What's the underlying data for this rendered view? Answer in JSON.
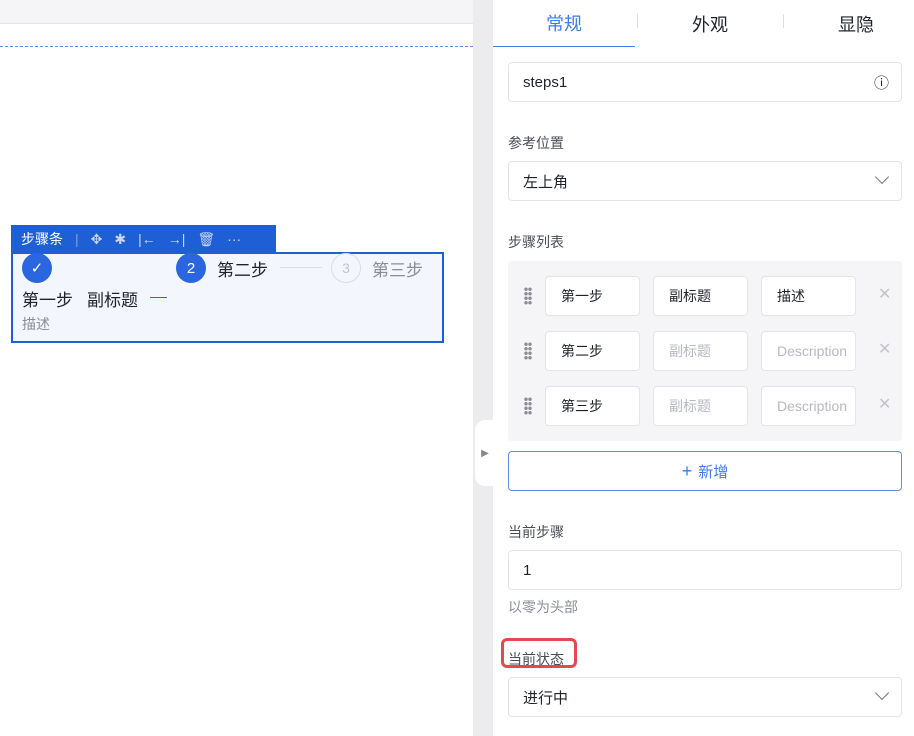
{
  "canvas": {
    "toolbar": {
      "title": "步骤条"
    },
    "steps": [
      {
        "title": "第一步",
        "subtitle": "副标题",
        "description": "描述",
        "status": "finish"
      },
      {
        "number": "2",
        "title": "第二步"
      },
      {
        "number": "3",
        "title": "第三步"
      }
    ]
  },
  "panel": {
    "tabs": [
      {
        "label": "常规",
        "active": true
      },
      {
        "label": "外观"
      },
      {
        "label": "显隐"
      }
    ],
    "name_value": "steps1",
    "position": {
      "label": "参考位置",
      "value": "左上角"
    },
    "steps_list": {
      "label": "步骤列表",
      "rows": [
        {
          "title": "第一步",
          "subtitle": "副标题",
          "description": "描述"
        },
        {
          "title": "第二步",
          "subtitle_placeholder": "副标题",
          "description_placeholder": "Description"
        },
        {
          "title": "第三步",
          "subtitle_placeholder": "副标题",
          "description_placeholder": "Description"
        }
      ],
      "add_label": "新增"
    },
    "current_step": {
      "label": "当前步骤",
      "value": "1",
      "hint": "以零为头部"
    },
    "current_status": {
      "label": "当前状态",
      "value": "进行中"
    }
  },
  "colors": {
    "accent": "#1f5fd6",
    "tab_active": "#3a7bf0",
    "highlight": "#e5484d"
  }
}
